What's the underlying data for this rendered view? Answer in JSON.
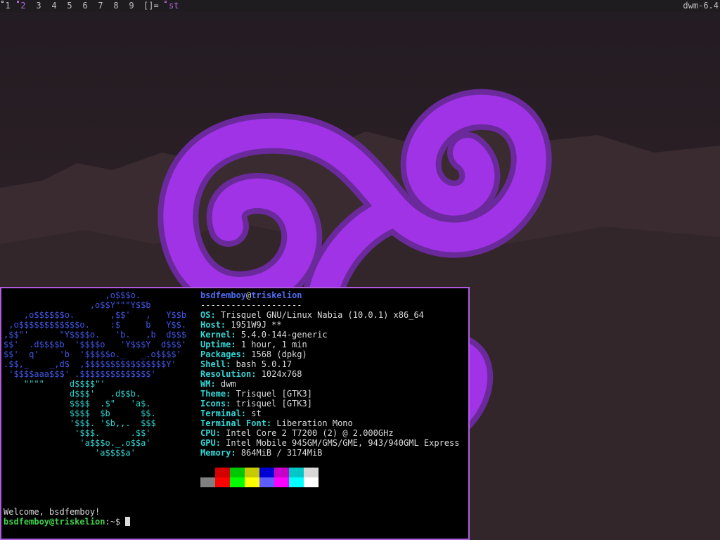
{
  "bar": {
    "tags": [
      "1",
      "2",
      "3",
      "4",
      "5",
      "6",
      "7",
      "8",
      "9"
    ],
    "selected_tag": "2",
    "layout_symbol": "[]=",
    "window_title": "st",
    "status_text": "dwm-6.4"
  },
  "colors": {
    "accent": "#b05be0",
    "swirl_fill": "#a033e6",
    "swirl_outline": "#6a2a9c",
    "info_key": "#35d6d6",
    "logo_blue": "#3f57e8",
    "prompt_green": "#3ed04a"
  },
  "terminal": {
    "logo": [
      "                    ,o$$$o.",
      "                 ,o$$Y\"\"\"Y$$b",
      "    ,o$$$$$$o.       ,$$'   ,   Y$$b",
      " ,o$$$$$$$$$$$$o.    :$     b   Y$$.",
      ",$$\"'      \"Y$$$$o.   'b.   ,b  d$$$",
      "$$'  .d$$$$b  '$$$$o   'Y$$$Y  d$$$'",
      "$$'  q'    'b  '$$$$$o._   _.o$$$$'",
      ".$$,_    _,d$  ,$$$$$$$$$$$$$$$$Y'",
      " '$$$$aaa$$$' .$$$$$$$$$$$$$$'",
      "    \"\"\"\"     d$$$$\"'",
      "             d$$$'   .d$$b.",
      "             $$$$  .$\"   'a$.",
      "             $$$$  $b      $$.",
      "             '$$$. '$b,,.  $$$",
      "              '$$$.      .$$'",
      "               'a$$$o._.o$$a'",
      "                  'a$$$$a'"
    ],
    "user": "bsdfemboy",
    "at": "@",
    "host": "triskelion",
    "separator": "--------------------",
    "info": [
      {
        "key": "OS",
        "value": "Trisquel GNU/Linux Nabia (10.0.1) x86_64"
      },
      {
        "key": "Host",
        "value": "1951W9J **"
      },
      {
        "key": "Kernel",
        "value": "5.4.0-144-generic"
      },
      {
        "key": "Uptime",
        "value": "1 hour, 1 min"
      },
      {
        "key": "Packages",
        "value": "1568 (dpkg)"
      },
      {
        "key": "Shell",
        "value": "bash 5.0.17"
      },
      {
        "key": "Resolution",
        "value": "1024x768"
      },
      {
        "key": "WM",
        "value": "dwm"
      },
      {
        "key": "Theme",
        "value": "Trisquel [GTK3]"
      },
      {
        "key": "Icons",
        "value": "trisquel [GTK3]"
      },
      {
        "key": "Terminal",
        "value": "st"
      },
      {
        "key": "Terminal Font",
        "value": "Liberation Mono"
      },
      {
        "key": "CPU",
        "value": "Intel Core 2 T7200 (2) @ 2.000GHz"
      },
      {
        "key": "GPU",
        "value": "Intel Mobile 945GM/GMS/GME, 943/940GML Express"
      },
      {
        "key": "Memory",
        "value": "864MiB / 3174MiB"
      }
    ],
    "palette_top": [
      "#000000",
      "#d40000",
      "#00c800",
      "#c8c800",
      "#0000d4",
      "#c800c8",
      "#00c8c8",
      "#d8d8d8"
    ],
    "palette_bottom": [
      "#808080",
      "#ff0000",
      "#00ff00",
      "#ffff00",
      "#5c5cff",
      "#ff00ff",
      "#00ffff",
      "#ffffff"
    ],
    "welcome": "Welcome, bsdfemboy!",
    "prompt_user": "bsdfemboy@triskelion",
    "prompt_suffix": ":~$ "
  }
}
